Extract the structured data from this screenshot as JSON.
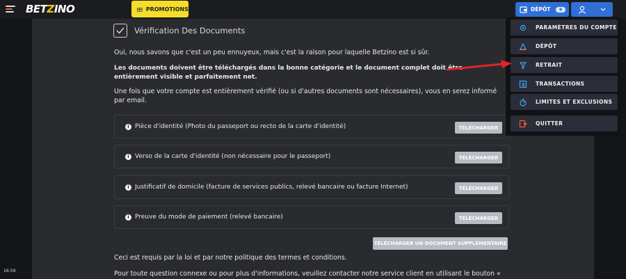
{
  "header": {
    "logo_prefix": "BET",
    "logo_z": "Z",
    "logo_suffix": "INO",
    "promotions_label": "PROMOTIONS",
    "depot_label": "DÉPÔT",
    "depot_eye_label": "◉"
  },
  "clock": "16:59",
  "documents": {
    "title": "Vérification Des Documents",
    "intro": "Oui, nous savons que c'est un peu ennuyeux, mais c'est la raison pour laquelle Betzino est si sûr.",
    "bold_notice": "Les documents doivent être téléchargés dans la bonne catégorie et le document complet doit être entièrement visible et parfaitement net.",
    "verified_notice": "Une fois que votre compte est entièrement vérifié (ou si d'autres documents sont nécessaires), vous en serez informé par email.",
    "rows": [
      {
        "label": "Pièce d'identité (Photo du passeport ou recto de la carte d'identité)",
        "button": "TÉLÉCHARGER"
      },
      {
        "label": "Verso de la carte d'identité (non nécessaire pour le passeport)",
        "button": "TÉLÉCHARGER"
      },
      {
        "label": "Justificatif de domicile (facture de services publics, relevé bancaire ou facture Internet)",
        "button": "TÉLÉCHARGER"
      },
      {
        "label": "Preuve du mode de paiement (relevé bancaire)",
        "button": "TÉLÉCHARGER"
      }
    ],
    "extra_upload": "TÉLÉCHARGER UN DOCUMENT SUPPLÉMENTAIRE",
    "law_notice": "Ceci est requis par la loi et par notre politique des termes et conditions.",
    "contact_notice": "Pour toute question connexe ou pour plus d'informations, veuillez contacter notre service client en utilisant le bouton «"
  },
  "account_menu": {
    "items": [
      {
        "label": "PARAMÈTRES DU COMPTE",
        "icon": "settings-icon"
      },
      {
        "label": "DÉPÔT",
        "icon": "deposit-icon"
      },
      {
        "label": "RETRAIT",
        "icon": "withdraw-icon"
      },
      {
        "label": "TRANSACTIONS",
        "icon": "transactions-icon"
      },
      {
        "label": "LIMITES ET EXCLUSIONS",
        "icon": "limits-icon"
      },
      {
        "label": "QUITTER",
        "icon": "logout-icon"
      }
    ]
  },
  "colors": {
    "brand_blue": "#2f6fd6",
    "promo_yellow": "#f5de2a",
    "annotation_red": "#e0242a",
    "upload_gray": "#b6bcc4"
  }
}
